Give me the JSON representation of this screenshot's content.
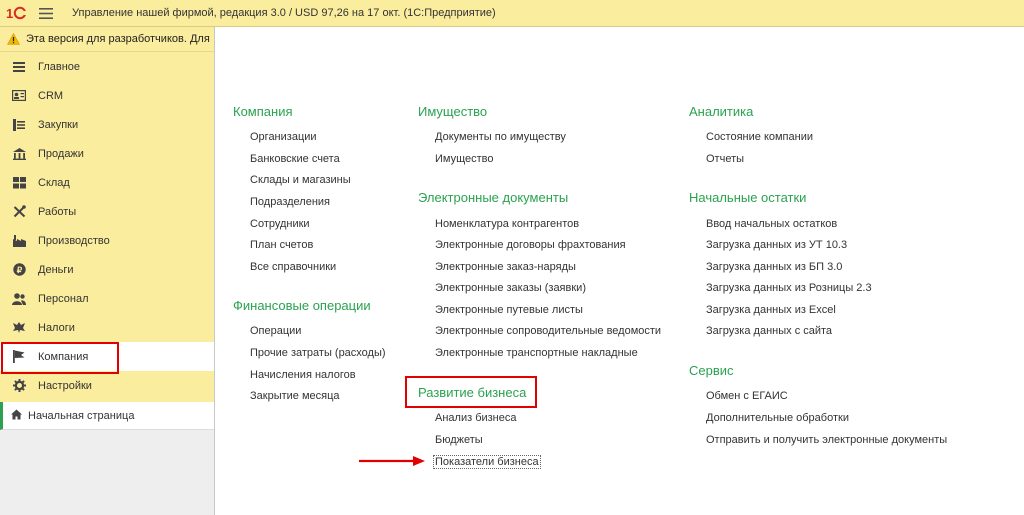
{
  "app": {
    "title": "Управление нашей фирмой, редакция 3.0 / USD 97,26 на 17 окт.  (1С:Предприятие)",
    "dev_notice": "Эта версия для разработчиков. Для"
  },
  "sidebar": {
    "items": [
      {
        "label": "Главное",
        "icon": "menu-lines-icon"
      },
      {
        "label": "CRM",
        "icon": "contact-card-icon"
      },
      {
        "label": "Закупки",
        "icon": "purchase-icon"
      },
      {
        "label": "Продажи",
        "icon": "shop-icon"
      },
      {
        "label": "Склад",
        "icon": "warehouse-icon"
      },
      {
        "label": "Работы",
        "icon": "tools-icon"
      },
      {
        "label": "Производство",
        "icon": "factory-icon"
      },
      {
        "label": "Деньги",
        "icon": "coin-icon"
      },
      {
        "label": "Персонал",
        "icon": "people-icon"
      },
      {
        "label": "Налоги",
        "icon": "emblem-icon"
      },
      {
        "label": "Компания",
        "icon": "flag-icon"
      },
      {
        "label": "Настройки",
        "icon": "gear-icon"
      }
    ],
    "active_index": 10,
    "home_tab": "Начальная страница"
  },
  "sections": {
    "kompaniya": {
      "title": "Компания",
      "links": [
        "Организации",
        "Банковские счета",
        "Склады и магазины",
        "Подразделения",
        "Сотрудники",
        "План счетов",
        "Все справочники"
      ]
    },
    "fin_ops": {
      "title": "Финансовые операции",
      "links": [
        "Операции",
        "Прочие затраты (расходы)",
        "Начисления налогов",
        "Закрытие месяца"
      ]
    },
    "imushchestvo": {
      "title": "Имущество",
      "links": [
        "Документы по имуществу",
        "Имущество"
      ]
    },
    "edocs": {
      "title": "Электронные документы",
      "links": [
        "Номенклатура контрагентов",
        "Электронные договоры фрахтования",
        "Электронные заказ-наряды",
        "Электронные заказы (заявки)",
        "Электронные путевые листы",
        "Электронные сопроводительные ведомости",
        "Электронные транспортные накладные"
      ]
    },
    "razvitie": {
      "title": "Развитие бизнеса",
      "links": [
        "Анализ бизнеса",
        "Бюджеты",
        "Показатели бизнеса"
      ]
    },
    "analitika": {
      "title": "Аналитика",
      "links": [
        "Состояние компании",
        "Отчеты"
      ]
    },
    "nach_ostatki": {
      "title": "Начальные остатки",
      "links": [
        "Ввод начальных остатков",
        "Загрузка данных из УТ 10.3",
        "Загрузка данных из БП 3.0",
        "Загрузка данных из Розницы 2.3",
        "Загрузка данных из Excel",
        "Загрузка данных с сайта"
      ]
    },
    "servis": {
      "title": "Сервис",
      "links": [
        "Обмен с ЕГАИС",
        "Дополнительные обработки",
        "Отправить и получить электронные документы"
      ]
    }
  },
  "colors": {
    "accent_bar": "#fbed9e",
    "section_title": "#2aa250",
    "highlight": "#e30000"
  }
}
